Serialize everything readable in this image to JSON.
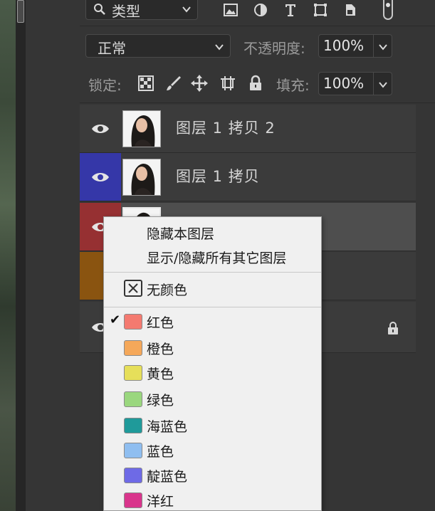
{
  "filter": {
    "kind_label": "类型"
  },
  "blend": {
    "mode": "正常",
    "opacity_label": "不透明度:",
    "opacity_value": "100%"
  },
  "lock": {
    "label": "锁定:",
    "fill_label": "填充:",
    "fill_value": "100%"
  },
  "layers": [
    {
      "name": "图层 1 拷贝 2",
      "color_tag": "none"
    },
    {
      "name": "图层 1 拷贝",
      "color_tag": "#3537a8"
    },
    {
      "name": "",
      "color_tag": "#963032"
    },
    {
      "name": "",
      "color_tag": "#8a5410"
    },
    {
      "name": "",
      "color_tag": "none",
      "locked": true
    }
  ],
  "context_menu": {
    "hide_layer": "隐藏本图层",
    "toggle_others": "显示/隐藏所有其它图层",
    "no_color": "无颜色",
    "colors": [
      {
        "label": "红色",
        "swatch": "#f47a70",
        "checked": true
      },
      {
        "label": "橙色",
        "swatch": "#f5a85a"
      },
      {
        "label": "黄色",
        "swatch": "#e6df5a"
      },
      {
        "label": "绿色",
        "swatch": "#9ad77e"
      },
      {
        "label": "海蓝色",
        "swatch": "#1f9a9a"
      },
      {
        "label": "蓝色",
        "swatch": "#8fbef0"
      },
      {
        "label": "靛蓝色",
        "swatch": "#6e6ae6"
      },
      {
        "label": "洋红",
        "swatch": "#d9358c"
      }
    ]
  }
}
